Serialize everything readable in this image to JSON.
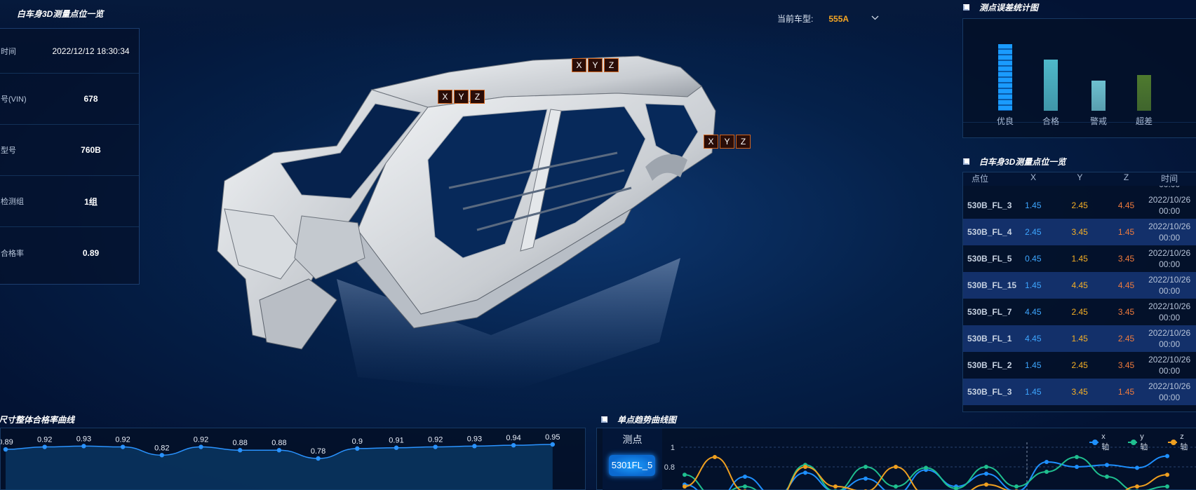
{
  "header": {
    "main_title": "白车身3D测量点位一览",
    "car_type_label": "当前车型:",
    "car_type_value": "555A"
  },
  "info_panel": {
    "rows": [
      {
        "label": "时间",
        "value": "2022/12/12 18:30:34"
      },
      {
        "label": "号(VIN)",
        "value": "678"
      },
      {
        "label": "型号",
        "value": "760B"
      },
      {
        "label": "检测组",
        "value": "1组"
      },
      {
        "label": "合格率",
        "value": "0.89"
      }
    ]
  },
  "markers": [
    "X",
    "Y",
    "Z"
  ],
  "error_stats": {
    "title": "测点误差统计图",
    "chart_data": {
      "type": "bar",
      "categories": [
        "优良",
        "合格",
        "警戒",
        "超差"
      ],
      "values": [
        95,
        73,
        43,
        51
      ],
      "colors": [
        "#1a9bff",
        "#4fb8c9",
        "#6ec1d0",
        "#4e7a2e"
      ]
    }
  },
  "points_table": {
    "title": "白车身3D测量点位一览",
    "headers": [
      "点位",
      "X",
      "Y",
      "Z",
      "时间"
    ],
    "partial_top_time": "00:00",
    "rows": [
      {
        "name": "530B_FL_3",
        "x": "1.45",
        "y": "2.45",
        "z": "4.45",
        "date": "2022/10/26",
        "time": "00:00"
      },
      {
        "name": "530B_FL_4",
        "x": "2.45",
        "y": "3.45",
        "z": "1.45",
        "date": "2022/10/26",
        "time": "00:00"
      },
      {
        "name": "530B_FL_5",
        "x": "0.45",
        "y": "1.45",
        "z": "3.45",
        "date": "2022/10/26",
        "time": "00:00"
      },
      {
        "name": "530B_FL_15",
        "x": "1.45",
        "y": "4.45",
        "z": "4.45",
        "date": "2022/10/26",
        "time": "00:00"
      },
      {
        "name": "530B_FL_7",
        "x": "4.45",
        "y": "2.45",
        "z": "3.45",
        "date": "2022/10/26",
        "time": "00:00"
      },
      {
        "name": "530B_FL_1",
        "x": "4.45",
        "y": "1.45",
        "z": "2.45",
        "date": "2022/10/26",
        "time": "00:00"
      },
      {
        "name": "530B_FL_2",
        "x": "1.45",
        "y": "2.45",
        "z": "3.45",
        "date": "2022/10/26",
        "time": "00:00"
      },
      {
        "name": "530B_FL_3",
        "x": "1.45",
        "y": "3.45",
        "z": "1.45",
        "date": "2022/10/26",
        "time": "00:00"
      }
    ]
  },
  "pass_rate_curve": {
    "title": "尺寸整体合格率曲线",
    "chart_data": {
      "type": "line",
      "values": [
        0.89,
        0.92,
        0.93,
        0.92,
        0.82,
        0.92,
        0.88,
        0.88,
        0.78,
        0.9,
        0.91,
        0.92,
        0.93,
        0.94,
        0.95
      ],
      "labels": [
        "0.89",
        "0.92",
        "0.93",
        "0.92",
        "0.82",
        "0.92",
        "0.88",
        "0.88",
        "0.78",
        "0.9",
        "0.91",
        "0.92",
        "0.93",
        "0.94",
        "0.95"
      ]
    }
  },
  "trend": {
    "title": "单点趋势曲线图",
    "point_header": "测点",
    "selected_point": "5301FL_5",
    "y_ticks": [
      "1",
      "0.8"
    ],
    "chart_data": {
      "type": "line",
      "series": [
        {
          "name": "x轴",
          "color": "#1e90ff",
          "values": [
            0.62,
            0.45,
            0.7,
            0.5,
            0.74,
            0.55,
            0.68,
            0.52,
            0.77,
            0.6,
            0.73,
            0.55,
            0.85,
            0.8,
            0.82,
            0.79,
            0.91
          ]
        },
        {
          "name": "y轴",
          "color": "#1fbf8f",
          "values": [
            0.72,
            0.5,
            0.6,
            0.45,
            0.82,
            0.55,
            0.8,
            0.6,
            0.79,
            0.58,
            0.8,
            0.6,
            0.75,
            0.9,
            0.7,
            0.55,
            0.6
          ]
        },
        {
          "name": "z轴",
          "color": "#f0a020",
          "values": [
            0.6,
            0.9,
            0.55,
            0.45,
            0.8,
            0.6,
            0.55,
            0.8,
            0.52,
            0.5,
            0.62,
            0.55,
            0.48,
            0.5,
            0.45,
            0.6,
            0.72
          ]
        }
      ]
    }
  }
}
